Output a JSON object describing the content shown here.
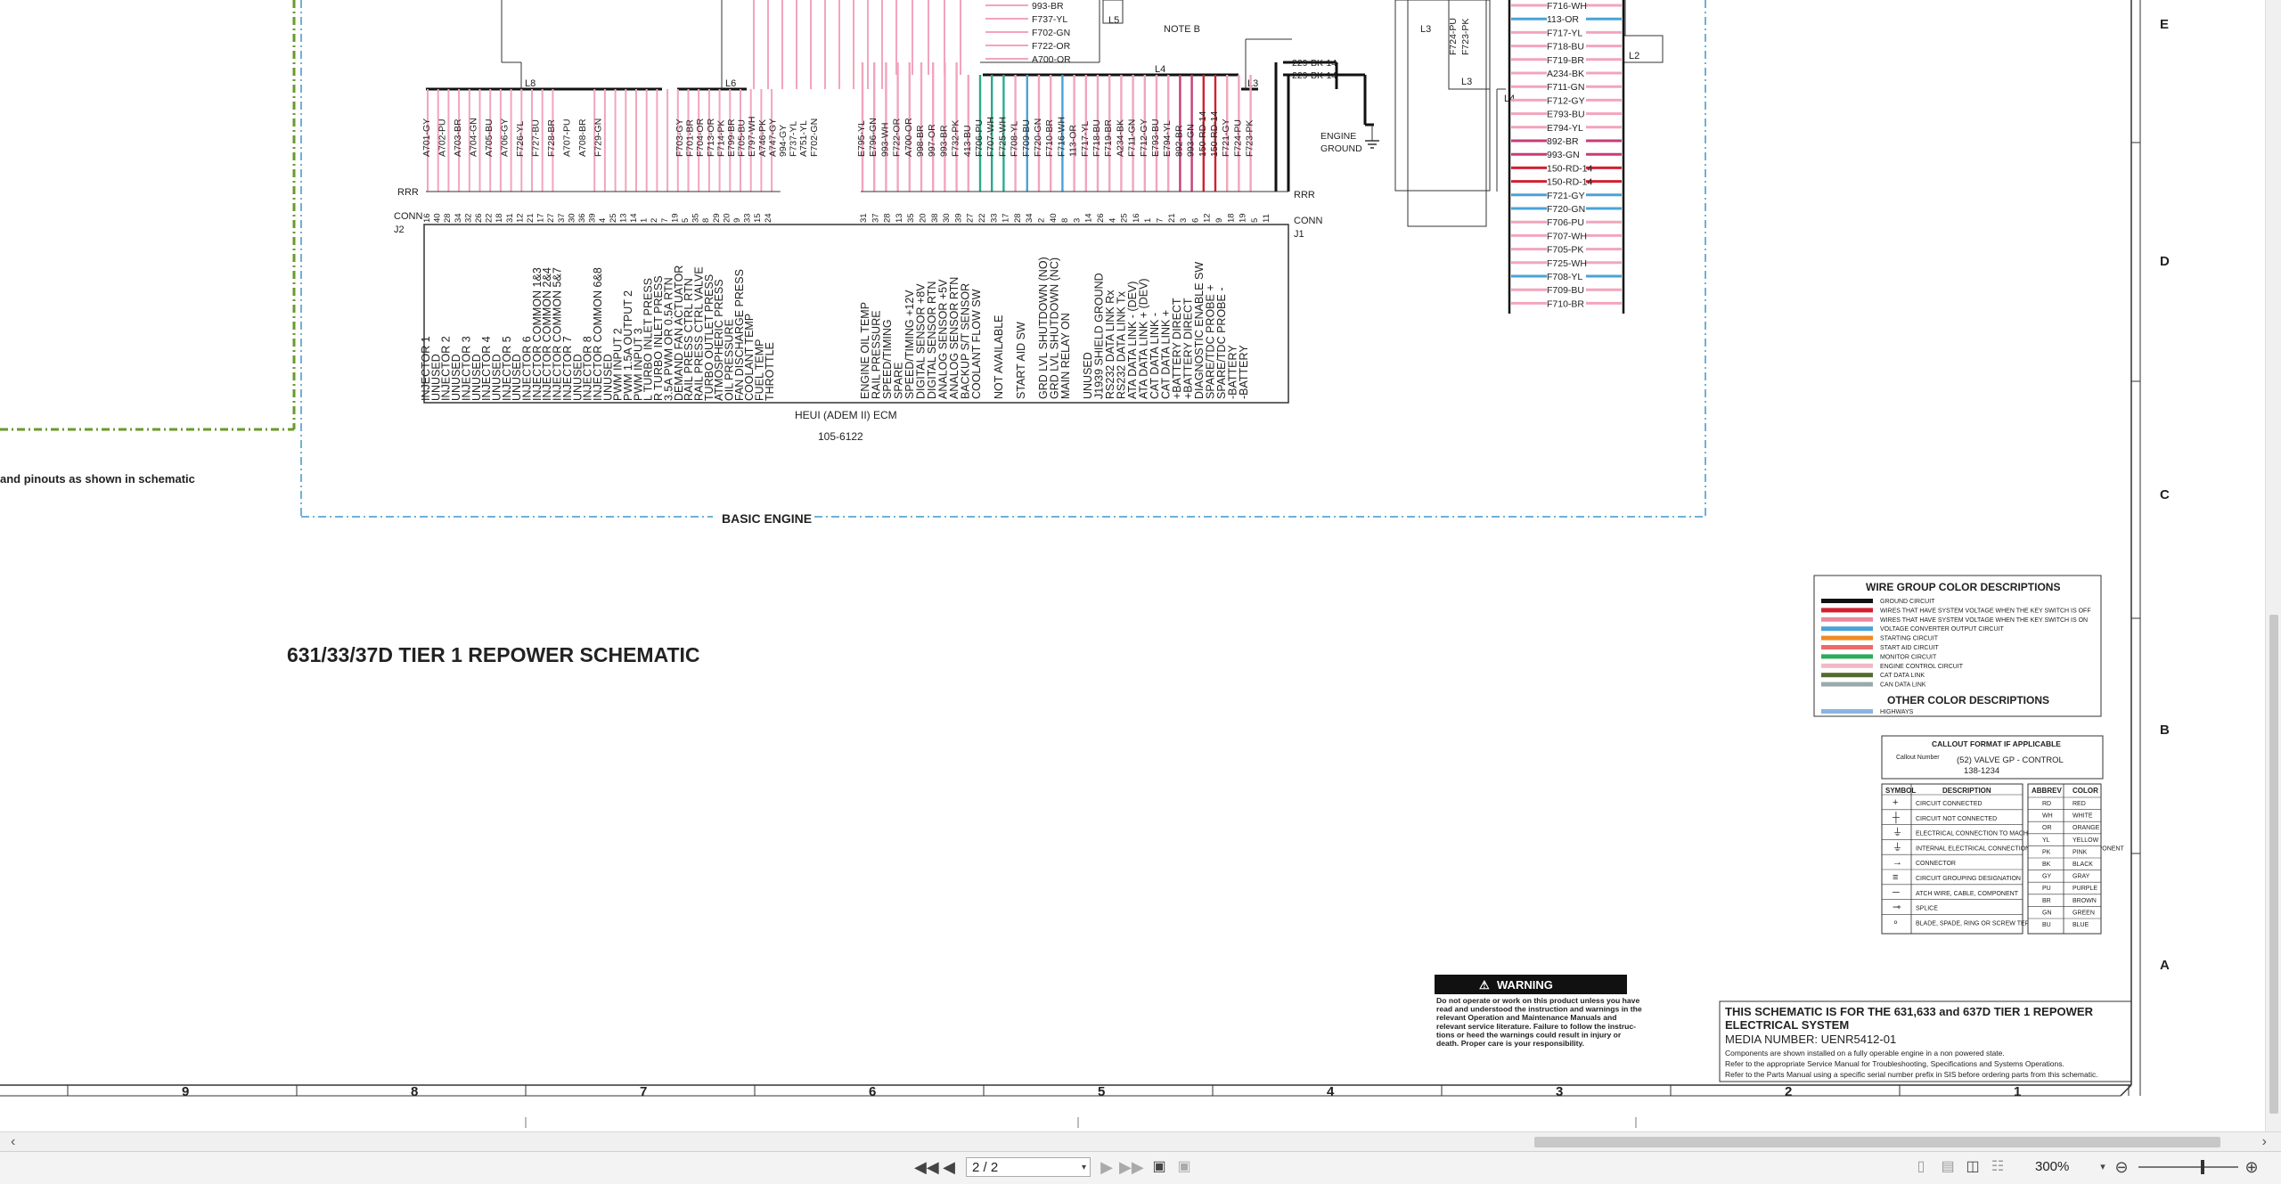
{
  "document": {
    "title": "631/33/37D TIER 1 REPOWER SCHEMATIC",
    "basic_engine_label": "BASIC ENGINE",
    "note_b": "NOTE B",
    "pinout_note": "and pinouts as shown in schematic",
    "engine_ground": [
      "ENGINE",
      "GROUND"
    ],
    "ecm_name": "HEUI (ADEM II) ECM",
    "ecm_part": "105-6122",
    "rrr": "RRR",
    "conn_j2": [
      "CONN",
      "J2"
    ],
    "conn_j1": [
      "CONN",
      "J1"
    ],
    "bundle_labels": [
      "L8",
      "L6",
      "L4",
      "L3",
      "L5",
      "L3",
      "L4",
      "L2"
    ],
    "top_wires": [
      "993-BR",
      "F737-YL",
      "F702-GN",
      "F722-OR",
      "A700-OR"
    ],
    "ground_wires": [
      "229-BK-14",
      "229-BK-14"
    ],
    "connector_top_wires": [
      "F724-PU",
      "F723-PK"
    ],
    "j2_wires": [
      "A701-GY",
      "A702-PU",
      "A703-BR",
      "A704-GN",
      "A705-BU",
      "A706-GY",
      "F726-YL",
      "F727-BU",
      "F728-BR",
      "A707-PU",
      "A708-BR",
      "F729-GN",
      "F703-GY",
      "F701-BR",
      "F704-OR",
      "F713-OR",
      "F714-PK",
      "E799-BR",
      "F705-BU",
      "E797-WH",
      "A746-PK",
      "A747-GY",
      "994-GY",
      "F737-YL",
      "A751-YL",
      "F702-GN"
    ],
    "j2_pins": [
      "16",
      "40",
      "28",
      "34",
      "32",
      "26",
      "22",
      "18",
      "31",
      "12",
      "21",
      "17",
      "27",
      "37",
      "30",
      "36",
      "39",
      "4",
      "25",
      "13",
      "14",
      "1",
      "2",
      "7",
      "19",
      "5",
      "35",
      "8",
      "29",
      "20",
      "9",
      "33",
      "15",
      "24"
    ],
    "j2_funcs": [
      "INJECTOR 1",
      "UNUSED",
      "INJECTOR 2",
      "UNUSED",
      "INJECTOR 3",
      "UNUSED",
      "INJECTOR 4",
      "UNUSED",
      "INJECTOR 5",
      "UNUSED",
      "INJECTOR 6",
      "INJECTOR COMMON 1&3",
      "INJECTOR COMMON 2&4",
      "INJECTOR COMMON 5&7",
      "INJECTOR 7",
      "UNUSED",
      "INJECTOR 8",
      "INJECTOR COMMON 6&8",
      "UNUSED",
      "PWM INPUT 2",
      "PWM 1.5A OUTPUT 2",
      "PWM INPUT 3",
      "L TURBO INLET PRESS",
      "R TURBO INLET PRESS",
      "3.5A PWM OR 0.5A RTN",
      "DEMAND FAN ACTUATOR",
      "RAIL PRESS CTRL RTN",
      "RAIL PRESS CTRL VALVE",
      "TURBO OUTLET PRESS",
      "ATMOSPHERIC PRESS",
      "OIL PRESSURE",
      "FAN DISCHARGE PRESS",
      "COOLANT TEMP",
      "FUEL TEMP",
      "THROTTLE"
    ],
    "j1_wires": [
      "E795-YL",
      "E796-GN",
      "993-WH",
      "F722-OR",
      "A700-OR",
      "998-BR",
      "997-OR",
      "993-BR",
      "F732-PK",
      "413-BU",
      "F706-PU",
      "F707-WH",
      "F725-WH",
      "F708-YL",
      "F709-BU",
      "F720-GN",
      "F710-BR",
      "F716-WH",
      "113-OR",
      "F717-YL",
      "F718-BU",
      "F719-BR",
      "A234-BK",
      "F711-GN",
      "F712-GY",
      "E793-BU",
      "E794-YL",
      "892-BR",
      "993-GN",
      "150-RD-14",
      "150-RD-14",
      "F721-GY",
      "F724-PU",
      "F723-PK"
    ],
    "j1_pins": [
      "31",
      "37",
      "28",
      "13",
      "35",
      "20",
      "38",
      "30",
      "39",
      "27",
      "22",
      "33",
      "17",
      "28",
      "34",
      "2",
      "40",
      "8",
      "3",
      "14",
      "26",
      "4",
      "25",
      "16",
      "1",
      "7",
      "21",
      "3",
      "6",
      "12",
      "9",
      "18",
      "19",
      "5",
      "11"
    ],
    "j1_funcs": [
      "ENGINE OIL TEMP",
      "RAIL PRESSURE",
      "SPEED/TIMING",
      "SPARE",
      "SPEED/TIMING +12V",
      "DIGITAL SENSOR +8V",
      "DIGITAL SENSOR RTN",
      "ANALOG SENSOR +5V",
      "ANALOG SENSOR RTN",
      "BACKUP S/T SENSOR",
      "COOLANT FLOW SW",
      "",
      "NOT AVAILABLE",
      "",
      "START AID SW",
      "",
      "GRD LVL SHUTDOWN (NO)",
      "GRD LVL SHUTDOWN (NC)",
      "MAIN RELAY ON",
      "",
      "UNUSED",
      "J1939 SHIELD GROUND",
      "RS232 DATA LINK Rx",
      "RS232 DATA LINK Tx",
      "ATA DATA LINK - (DEV)",
      "ATA DATA LINK + (DEV)",
      "CAT DATA LINK -",
      "CAT DATA LINK +",
      "+BATTERY DIRECT",
      "+BATTERY DIRECT",
      "DIAGNOSTIC ENABLE SW",
      "SPARE/TDC PROBE +",
      "SPARE/TDC PROBE -",
      "-BATTERY",
      "-BATTERY"
    ],
    "right_bundle": [
      "F716-WH",
      "113-OR",
      "F717-YL",
      "F718-BU",
      "F719-BR",
      "A234-BK",
      "F711-GN",
      "F712-GY",
      "E793-BU",
      "E794-YL",
      "892-BR",
      "993-GN",
      "150-RD-14",
      "150-RD-14",
      "F721-GY",
      "F720-GN",
      "F706-PU",
      "F707-WH",
      "F705-PK",
      "F725-WH",
      "F708-YL",
      "F709-BU",
      "F710-BR"
    ],
    "legend": {
      "wire_title": "WIRE GROUP COLOR DESCRIPTIONS",
      "wire_rows": [
        {
          "color": "#111111",
          "label": "GROUND CIRCUIT"
        },
        {
          "color": "#d22030",
          "label": "WIRES THAT HAVE SYSTEM VOLTAGE WHEN THE KEY SWITCH IS OFF"
        },
        {
          "color": "#e98aa0",
          "label": "WIRES THAT HAVE SYSTEM VOLTAGE WHEN THE KEY SWITCH IS ON"
        },
        {
          "color": "#4aa3d8",
          "label": "VOLTAGE CONVERTER OUTPUT CIRCUIT"
        },
        {
          "color": "#f08a24",
          "label": "STARTING CIRCUIT"
        },
        {
          "color": "#f06868",
          "label": "START AID CIRCUIT"
        },
        {
          "color": "#2eaa5a",
          "label": "MONITOR CIRCUIT"
        },
        {
          "color": "#f3b8c8",
          "label": "ENGINE CONTROL CIRCUIT"
        },
        {
          "color": "#556b2f",
          "label": "CAT DATA LINK"
        },
        {
          "color": "#9aa",
          "label": "CAN DATA LINK"
        }
      ],
      "other_title": "OTHER COLOR DESCRIPTIONS",
      "other_rows": [
        {
          "color": "#8ab4e0",
          "label": "HIGHWAYS"
        }
      ],
      "callout_title": "CALLOUT FORMAT IF APPLICABLE",
      "callout_line1": "(52) VALVE GP - CONTROL",
      "callout_line2": "138-1234",
      "callout_small": "Callout Number",
      "symbol_header": [
        "SYMBOL",
        "DESCRIPTION"
      ],
      "symbol_rows": [
        "CIRCUIT CONNECTED",
        "CIRCUIT NOT CONNECTED",
        "ELECTRICAL CONNECTION TO MACHINE STRUCTURE",
        "INTERNAL ELECTRICAL CONNECTION TO SURFACE OF COMPONENT",
        "CONNECTOR",
        "CIRCUIT GROUPING DESIGNATION",
        "ATCH WIRE, CABLE, COMPONENT",
        "SPLICE",
        "BLADE, SPADE, RING OR SCREW TERMINAL"
      ],
      "abbrev_header": [
        "ABBREV",
        "COLOR"
      ],
      "abbrev_rows": [
        [
          "RD",
          "RED"
        ],
        [
          "WH",
          "WHITE"
        ],
        [
          "OR",
          "ORANGE"
        ],
        [
          "YL",
          "YELLOW"
        ],
        [
          "PK",
          "PINK"
        ],
        [
          "BK",
          "BLACK"
        ],
        [
          "GY",
          "GRAY"
        ],
        [
          "PU",
          "PURPLE"
        ],
        [
          "BR",
          "BROWN"
        ],
        [
          "GN",
          "GREEN"
        ],
        [
          "BU",
          "BLUE"
        ]
      ]
    },
    "warning": {
      "title": "WARNING",
      "text": [
        "Do not operate or work on this product unless you have",
        "read and understood the instruction and warnings in the",
        "relevant Operation and Maintenance Manuals and",
        "relevant service literature. Failure to follow the instruc-",
        "tions or heed the warnings could result in injury or",
        "death. Proper care is your responsibility."
      ]
    },
    "title_block": {
      "line1": "THIS SCHEMATIC IS FOR THE 631,633 and 637D TIER 1 REPOWER",
      "line2": "ELECTRICAL SYSTEM",
      "media": "MEDIA NUMBER: UENR5412-01",
      "notes": [
        "Components are shown installed on a fully operable engine in a non powered state.",
        "Refer to the appropriate Service Manual for Troubleshooting, Specifications and Systems Operations.",
        "Refer to the Parts Manual using a specific serial number prefix in SIS before ordering parts from this schematic."
      ]
    },
    "column_numbers": [
      "9",
      "8",
      "7",
      "6",
      "5",
      "4",
      "3",
      "2",
      "1"
    ],
    "row_letters": [
      "E",
      "D",
      "C",
      "B",
      "A"
    ]
  },
  "viewer": {
    "page_field": "2 / 2",
    "zoom": "300%",
    "first_page_icon": "first-page-icon",
    "prev_page_icon": "prev-page-icon",
    "next_page_icon": "next-page-icon",
    "last_page_icon": "last-page-icon"
  },
  "colors": {
    "ecm_wire_pink": "#f2a5bd",
    "highway_blue": "#8ab4e0",
    "engine_border": "#6fb0d8",
    "machine_border": "#6a9a2a"
  }
}
